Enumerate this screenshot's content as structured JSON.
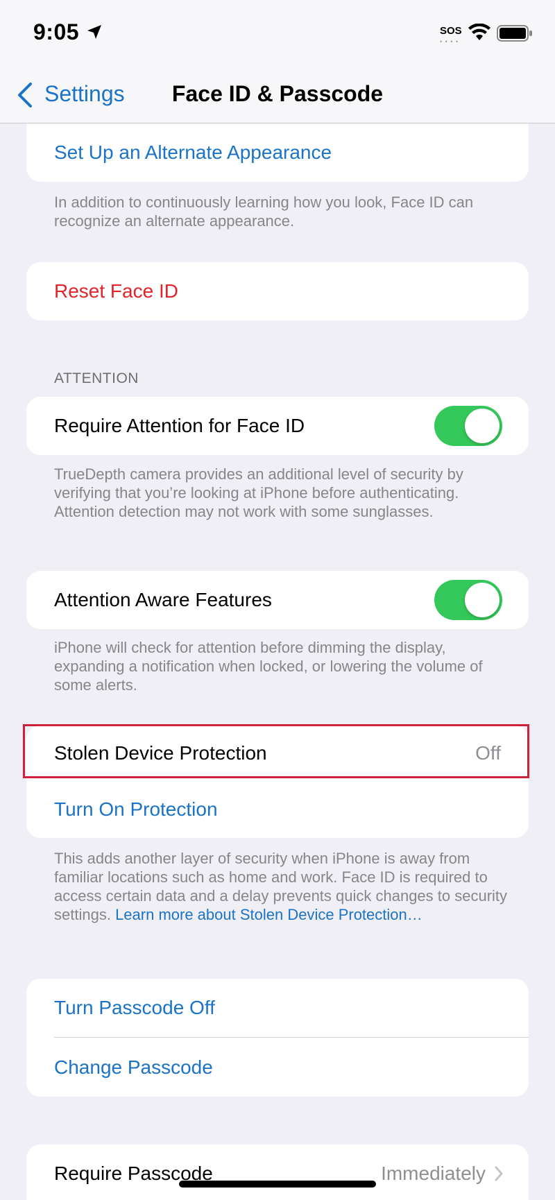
{
  "status_bar": {
    "time": "9:05",
    "sos": "SOS",
    "sos_dots": "• • • •"
  },
  "nav": {
    "back_label": "Settings",
    "title": "Face ID & Passcode"
  },
  "alt_appearance": {
    "label": "Set Up an Alternate Appearance",
    "footer": "In addition to continuously learning how you look, Face ID can recognize an alternate appearance."
  },
  "reset": {
    "label": "Reset Face ID"
  },
  "attention": {
    "header": "ATTENTION",
    "require": {
      "label": "Require Attention for Face ID",
      "enabled": true
    },
    "require_footer": "TrueDepth camera provides an additional level of security by verifying that you’re looking at iPhone before authenticating. Attention detection may not work with some sunglasses.",
    "aware": {
      "label": "Attention Aware Features",
      "enabled": true
    },
    "aware_footer": "iPhone will check for attention before dimming the display, expanding a notification when locked, or lowering the volume of some alerts."
  },
  "stolen": {
    "label": "Stolen Device Protection",
    "value": "Off",
    "turn_on_label": "Turn On Protection",
    "footer": "This adds another layer of security when iPhone is away from familiar locations such as home and work. Face ID is required to access certain data and a delay prevents quick changes to security settings.",
    "learn_more": "Learn more about Stolen Device Protection…"
  },
  "passcode": {
    "turn_off_label": "Turn Passcode Off",
    "change_label": "Change Passcode"
  },
  "require_passcode": {
    "label": "Require Passcode",
    "value": "Immediately"
  },
  "colors": {
    "accent": "#1a73c7",
    "destructive": "#e0242a",
    "toggle_on": "#34c759",
    "highlight": "#d0213a"
  },
  "icons": {
    "location": "location-arrow-icon",
    "wifi": "wifi-icon",
    "battery": "battery-icon",
    "back": "chevron-left-icon",
    "disclosure": "chevron-right-icon"
  }
}
